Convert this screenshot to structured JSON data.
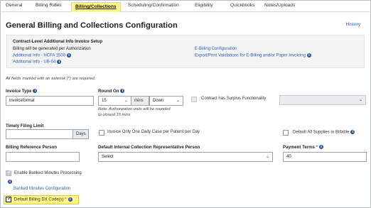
{
  "tabs": [
    {
      "label": "General"
    },
    {
      "label": "Billing Rates"
    },
    {
      "label": "Billing/Collections"
    },
    {
      "label": "Scheduling/Confirmation"
    },
    {
      "label": "Eligibility"
    },
    {
      "label": "Quickbooks"
    },
    {
      "label": "Notes/Uploads"
    }
  ],
  "page": {
    "title": "General Billing and Collections Configuration",
    "history": "History"
  },
  "setup": {
    "title": "Contract-Level Additional Info Invoice Setup",
    "status": "Billing will be generated per Authorization",
    "link_hcfa": "Additional Info - HCFA 1500",
    "link_ub": "Additional Info - UB-04",
    "link_ebilling": "E-Billing Configuration",
    "link_export": "Export/Print Validations for E-Billing and/or Paper Invoicing"
  },
  "required_note": {
    "prefix": "All fields marked with an asterisk (",
    "asterisk": "*",
    "suffix": ") are required."
  },
  "invoice_type": {
    "label": "Invoice Type",
    "value": "invoiceformat"
  },
  "round_on": {
    "label": "Round On",
    "value": "15",
    "unit": "mins",
    "direction": "Down",
    "note_line1": "Note: Authorization units will be rounded",
    "note_line2": "to closest 15 mins"
  },
  "surplus": {
    "label": "Contract has Surplus Functionality"
  },
  "timely_filing": {
    "label": "Timely Filing Limit",
    "value": "",
    "unit": "Days"
  },
  "one_daily_case": {
    "label": "Invoice Only One Daily Case per Patient per Day"
  },
  "supplies_billable": {
    "label": "Default All Supplies to Billable"
  },
  "billing_ref": {
    "label": "Billing Reference Person",
    "value": ""
  },
  "collection_rep": {
    "label": "Default Internal Collection Representative Person",
    "value": "Select"
  },
  "payment_terms": {
    "label": "Payment Terms",
    "asterisk": "*",
    "value": "40"
  },
  "banked_minutes": {
    "label": "Enable Banked Minutes Processing",
    "link": "Banked Minutes Configuration"
  },
  "dx_codes": {
    "label": "Default Billing DX Code(s)",
    "asterisk": "*"
  },
  "icons": {
    "info": "info-circle-icon",
    "dropdown": "chevron-down-icon",
    "check": "checkmark-icon"
  },
  "colors": {
    "accent_highlight": "#fff685",
    "link": "#2f5fb0",
    "info_icon": "#2b50a6",
    "required": "#c0282d"
  }
}
